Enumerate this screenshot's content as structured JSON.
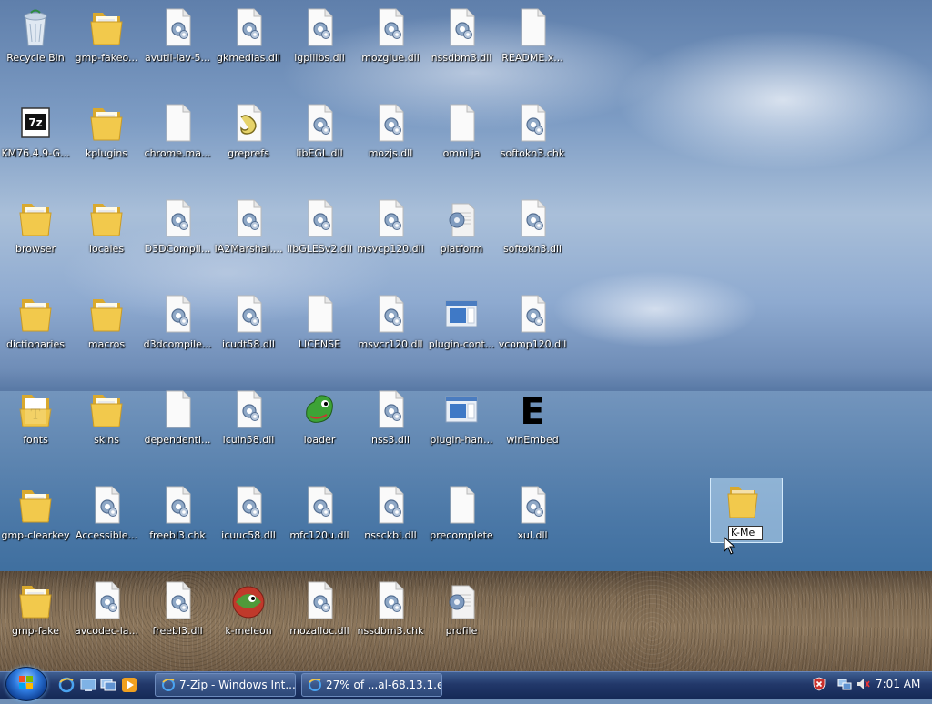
{
  "desktop": {
    "icons": [
      {
        "label": "Recycle Bin",
        "type": "recycle",
        "col": 0,
        "row": 0
      },
      {
        "label": "gmp-fakeo...",
        "type": "folder",
        "col": 1,
        "row": 0
      },
      {
        "label": "avutil-lav-5...",
        "type": "dll",
        "col": 2,
        "row": 0
      },
      {
        "label": "gkmedias.dll",
        "type": "dll",
        "col": 3,
        "row": 0
      },
      {
        "label": "lgpllibs.dll",
        "type": "dll",
        "col": 4,
        "row": 0
      },
      {
        "label": "mozglue.dll",
        "type": "dll",
        "col": 5,
        "row": 0
      },
      {
        "label": "nssdbm3.dll",
        "type": "dll",
        "col": 6,
        "row": 0
      },
      {
        "label": "README.x...",
        "type": "file",
        "col": 7,
        "row": 0
      },
      {
        "label": "KM76.4.9-G...",
        "type": "7z",
        "col": 0,
        "row": 1
      },
      {
        "label": "kplugins",
        "type": "folder",
        "col": 1,
        "row": 1
      },
      {
        "label": "chrome.ma...",
        "type": "file",
        "col": 2,
        "row": 1
      },
      {
        "label": "greprefs",
        "type": "script",
        "col": 3,
        "row": 1
      },
      {
        "label": "libEGL.dll",
        "type": "dll",
        "col": 4,
        "row": 1
      },
      {
        "label": "mozjs.dll",
        "type": "dll",
        "col": 5,
        "row": 1
      },
      {
        "label": "omni.ja",
        "type": "file",
        "col": 6,
        "row": 1
      },
      {
        "label": "softokn3.chk",
        "type": "dll",
        "col": 7,
        "row": 1
      },
      {
        "label": "browser",
        "type": "folder",
        "col": 0,
        "row": 2
      },
      {
        "label": "locales",
        "type": "folder",
        "col": 1,
        "row": 2
      },
      {
        "label": "D3DCompil...",
        "type": "dll",
        "col": 2,
        "row": 2
      },
      {
        "label": "IA2Marshal....",
        "type": "dll",
        "col": 3,
        "row": 2
      },
      {
        "label": "libGLESv2.dll",
        "type": "dll",
        "col": 4,
        "row": 2
      },
      {
        "label": "msvcp120.dll",
        "type": "dll",
        "col": 5,
        "row": 2
      },
      {
        "label": "platform",
        "type": "config",
        "col": 6,
        "row": 2
      },
      {
        "label": "softokn3.dll",
        "type": "dll",
        "col": 7,
        "row": 2
      },
      {
        "label": "dictionaries",
        "type": "folder",
        "col": 0,
        "row": 3
      },
      {
        "label": "macros",
        "type": "folder",
        "col": 1,
        "row": 3
      },
      {
        "label": "d3dcompile...",
        "type": "dll",
        "col": 2,
        "row": 3
      },
      {
        "label": "icudt58.dll",
        "type": "dll",
        "col": 3,
        "row": 3
      },
      {
        "label": "LICENSE",
        "type": "file",
        "col": 4,
        "row": 3
      },
      {
        "label": "msvcr120.dll",
        "type": "dll",
        "col": 5,
        "row": 3
      },
      {
        "label": "plugin-cont...",
        "type": "exe",
        "col": 6,
        "row": 3
      },
      {
        "label": "vcomp120.dll",
        "type": "dll",
        "col": 7,
        "row": 3
      },
      {
        "label": "fonts",
        "type": "fontfolder",
        "col": 0,
        "row": 4
      },
      {
        "label": "skins",
        "type": "folder",
        "col": 1,
        "row": 4
      },
      {
        "label": "dependentl...",
        "type": "file",
        "col": 2,
        "row": 4
      },
      {
        "label": "icuin58.dll",
        "type": "dll",
        "col": 3,
        "row": 4
      },
      {
        "label": "loader",
        "type": "loader",
        "col": 4,
        "row": 4
      },
      {
        "label": "nss3.dll",
        "type": "dll",
        "col": 5,
        "row": 4
      },
      {
        "label": "plugin-han...",
        "type": "exe",
        "col": 6,
        "row": 4
      },
      {
        "label": "winEmbed",
        "type": "winembed",
        "col": 7,
        "row": 4
      },
      {
        "label": "gmp-clearkey",
        "type": "folder",
        "col": 0,
        "row": 5
      },
      {
        "label": "Accessible...",
        "type": "dll",
        "col": 1,
        "row": 5
      },
      {
        "label": "freebl3.chk",
        "type": "dll",
        "col": 2,
        "row": 5
      },
      {
        "label": "icuuc58.dll",
        "type": "dll",
        "col": 3,
        "row": 5
      },
      {
        "label": "mfc120u.dll",
        "type": "dll",
        "col": 4,
        "row": 5
      },
      {
        "label": "nssckbi.dll",
        "type": "dll",
        "col": 5,
        "row": 5
      },
      {
        "label": "precomplete",
        "type": "file",
        "col": 6,
        "row": 5
      },
      {
        "label": "xul.dll",
        "type": "dll",
        "col": 7,
        "row": 5
      },
      {
        "label": "gmp-fake",
        "type": "folder",
        "col": 0,
        "row": 6
      },
      {
        "label": "avcodec-la...",
        "type": "dll",
        "col": 1,
        "row": 6
      },
      {
        "label": "freebl3.dll",
        "type": "dll",
        "col": 2,
        "row": 6
      },
      {
        "label": "k-meleon",
        "type": "kmeleon",
        "col": 3,
        "row": 6
      },
      {
        "label": "mozalloc.dll",
        "type": "dll",
        "col": 4,
        "row": 6
      },
      {
        "label": "nssdbm3.chk",
        "type": "dll",
        "col": 5,
        "row": 6
      },
      {
        "label": "profile",
        "type": "config",
        "col": 6,
        "row": 6
      }
    ],
    "renaming_folder": {
      "value": "K-Me"
    }
  },
  "taskbar": {
    "windows": [
      {
        "label": "7-Zip - Windows Int..."
      },
      {
        "label": "27% of ...al-68.13.1.e..."
      }
    ],
    "clock": "7:01 AM"
  },
  "colors": {
    "taskbar": "#22386a",
    "folder": "#f2c94c",
    "label_text": "#ffffff"
  }
}
